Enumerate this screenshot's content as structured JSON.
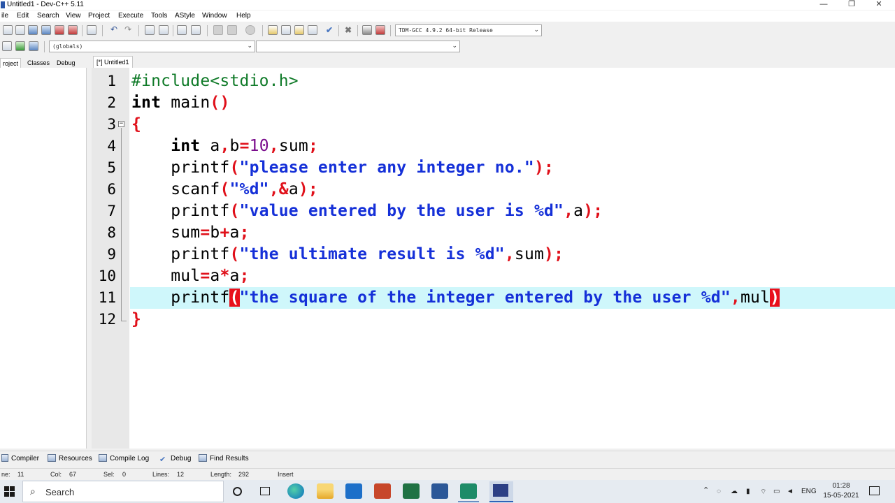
{
  "window": {
    "title": "Untitled1 - Dev-C++ 5.11",
    "controls": {
      "minimize": "—",
      "restore": "❐",
      "close": "✕"
    }
  },
  "menu": [
    "ile",
    "Edit",
    "Search",
    "View",
    "Project",
    "Execute",
    "Tools",
    "AStyle",
    "Window",
    "Help"
  ],
  "toolbar": {
    "compiler_select": "TDM-GCC 4.9.2 64-bit Release",
    "scope_select": "(globals)",
    "member_select": ""
  },
  "side_panel": {
    "tabs": [
      "roject",
      "Classes",
      "Debug"
    ]
  },
  "editor": {
    "tab_label": "[*] Untitled1",
    "line_numbers": [
      "1",
      "2",
      "3",
      "4",
      "5",
      "6",
      "7",
      "8",
      "9",
      "10",
      "11",
      "12"
    ]
  },
  "bottom_tabs": [
    "Compiler",
    "Resources",
    "Compile Log",
    "Debug",
    "Find Results"
  ],
  "status": {
    "line_label": "ne:",
    "line_value": "11",
    "col_label": "Col:",
    "col_value": "67",
    "sel_label": "Sel:",
    "sel_value": "0",
    "lines_label": "Lines:",
    "lines_value": "12",
    "length_label": "Length:",
    "length_value": "292",
    "mode": "Insert"
  },
  "taskbar": {
    "search_placeholder": "Search",
    "language": "ENG",
    "time": "01:28",
    "date": "15-05-2021"
  },
  "colors": {
    "keyword": "#000000",
    "symbol": "#e0101a",
    "string": "#1530d8",
    "number": "#7a0c8c",
    "preprocessor": "#0f7a28",
    "active_line": "#cff7fb",
    "bracket_match": "#e8101c"
  }
}
